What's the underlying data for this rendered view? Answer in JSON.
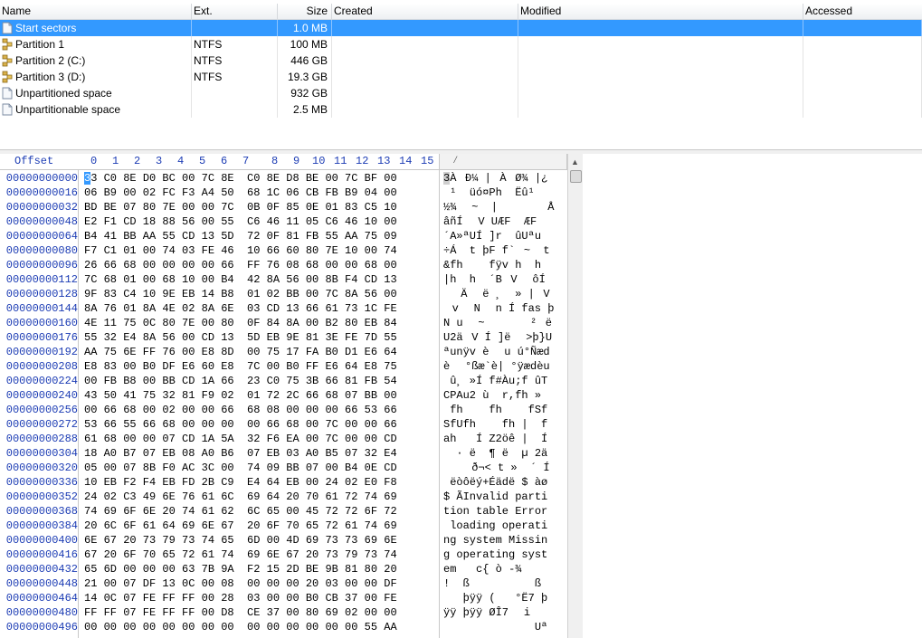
{
  "list": {
    "columns": [
      "Name",
      "Ext.",
      "Size",
      "Created",
      "Modified",
      "Accessed"
    ],
    "rows": [
      {
        "name": "Start sectors",
        "ext": "",
        "size": "1.0 MB",
        "icon": "sector-icon",
        "selected": true
      },
      {
        "name": "Partition 1",
        "ext": "NTFS",
        "size": "100 MB",
        "icon": "partition-icon"
      },
      {
        "name": "Partition 2 (C:)",
        "ext": "NTFS",
        "size": "446 GB",
        "icon": "partition-icon"
      },
      {
        "name": "Partition 3 (D:)",
        "ext": "NTFS",
        "size": "19.3 GB",
        "icon": "partition-icon"
      },
      {
        "name": "Unpartitioned space",
        "ext": "",
        "size": "932 GB",
        "icon": "sector-icon"
      },
      {
        "name": "Unpartitionable space",
        "ext": "",
        "size": "2.5 MB",
        "icon": "sector-icon"
      }
    ]
  },
  "hex": {
    "offset_label": "Offset",
    "col_headers": [
      "0",
      "1",
      "2",
      "3",
      "4",
      "5",
      "6",
      "7",
      "8",
      "9",
      "10",
      "11",
      "12",
      "13",
      "14",
      "15"
    ],
    "lines": [
      {
        "off": "00000000000",
        "bytes": "33 C0 8E D0 BC 00 7C 8E  C0 8E D8 BE 00 7C BF 00",
        "ascii": "3ÀĐ¼ |ÀØ¾ |¿"
      },
      {
        "off": "00000000016",
        "bytes": "06 B9 00 02 FC F3 A4 50  68 1C 06 CB FB B9 04 00",
        "ascii": " ¹  üó¤Ph  Ëû¹"
      },
      {
        "off": "00000000032",
        "bytes": "BD BE 07 80 7E 00 00 7C  0B 0F 85 0E 01 83 C5 10",
        "ascii": "½¾ ~  |     Å"
      },
      {
        "off": "00000000048",
        "bytes": "E2 F1 CD 18 88 56 00 55  C6 46 11 05 C6 46 10 00",
        "ascii": "âñÍ V UÆF  ÆF"
      },
      {
        "off": "00000000064",
        "bytes": "B4 41 BB AA 55 CD 13 5D  72 0F 81 FB 55 AA 75 09",
        "ascii": "´A»ªUÍ ]r  ûUªu"
      },
      {
        "off": "00000000080",
        "bytes": "F7 C1 01 00 74 03 FE 46  10 66 60 80 7E 10 00 74",
        "ascii": "÷Á  t þF f`~  t"
      },
      {
        "off": "00000000096",
        "bytes": "26 66 68 00 00 00 00 66  FF 76 08 68 00 00 68 00",
        "ascii": "&fh    fÿv h  h"
      },
      {
        "off": "00000000112",
        "bytes": "7C 68 01 00 68 10 00 B4  42 8A 56 00 8B F4 CD 13",
        "ascii": "|h  h  ´BV ôÍ"
      },
      {
        "off": "00000000128",
        "bytes": "9F 83 C4 10 9E EB 14 B8  01 02 BB 00 7C 8A 56 00",
        "ascii": "Ä ë ¸  » |V"
      },
      {
        "off": "00000000144",
        "bytes": "8A 76 01 8A 4E 02 8A 6E  03 CD 13 66 61 73 1C FE",
        "ascii": "v N n Í fas þ"
      },
      {
        "off": "00000000160",
        "bytes": "4E 11 75 0C 80 7E 00 80  0F 84 8A 00 B2 80 EB 84",
        "ascii": "N u ~   ²ë"
      },
      {
        "off": "00000000176",
        "bytes": "55 32 E4 8A 56 00 CD 13  5D EB 9E 81 3E FE 7D 55",
        "ascii": "U2äV Í ]ë >þ}U"
      },
      {
        "off": "00000000192",
        "bytes": "AA 75 6E FF 76 00 E8 8D  00 75 17 FA B0 D1 E6 64",
        "ascii": "ªunÿv è u ú°Ñæd"
      },
      {
        "off": "00000000208",
        "bytes": "E8 83 00 B0 DF E6 60 E8  7C 00 B0 FF E6 64 E8 75",
        "ascii": "è °ßæ`è| °ÿædèu"
      },
      {
        "off": "00000000224",
        "bytes": "00 FB B8 00 BB CD 1A 66  23 C0 75 3B 66 81 FB 54",
        "ascii": " û¸ »Í f#Àu;f ûT"
      },
      {
        "off": "00000000240",
        "bytes": "43 50 41 75 32 81 F9 02  01 72 2C 66 68 07 BB 00",
        "ascii": "CPAu2 ù  r,fh »"
      },
      {
        "off": "00000000256",
        "bytes": "00 66 68 00 02 00 00 66  68 08 00 00 00 66 53 66",
        "ascii": " fh    fh    fSf"
      },
      {
        "off": "00000000272",
        "bytes": "53 66 55 66 68 00 00 00  00 66 68 00 7C 00 00 66",
        "ascii": "SfUfh    fh |  f"
      },
      {
        "off": "00000000288",
        "bytes": "61 68 00 00 07 CD 1A 5A  32 F6 EA 00 7C 00 00 CD",
        "ascii": "ah   Í Z2öê |  Í"
      },
      {
        "off": "00000000304",
        "bytes": "18 A0 B7 07 EB 08 A0 B6  07 EB 03 A0 B5 07 32 E4",
        "ascii": "  · ë  ¶ ë  µ 2ä"
      },
      {
        "off": "00000000320",
        "bytes": "05 00 07 8B F0 AC 3C 00  74 09 BB 07 00 B4 0E CD",
        "ascii": "   ð¬< t »  ´ Í"
      },
      {
        "off": "00000000336",
        "bytes": "10 EB F2 F4 EB FD 2B C9  E4 64 EB 00 24 02 E0 F8",
        "ascii": " ëòôëý+Éädë $ àø"
      },
      {
        "off": "00000000352",
        "bytes": "24 02 C3 49 6E 76 61 6C  69 64 20 70 61 72 74 69",
        "ascii": "$ ÃInvalid parti"
      },
      {
        "off": "00000000368",
        "bytes": "74 69 6F 6E 20 74 61 62  6C 65 00 45 72 72 6F 72",
        "ascii": "tion table Error"
      },
      {
        "off": "00000000384",
        "bytes": "20 6C 6F 61 64 69 6E 67  20 6F 70 65 72 61 74 69",
        "ascii": " loading operati"
      },
      {
        "off": "00000000400",
        "bytes": "6E 67 20 73 79 73 74 65  6D 00 4D 69 73 73 69 6E",
        "ascii": "ng system Missin"
      },
      {
        "off": "00000000416",
        "bytes": "67 20 6F 70 65 72 61 74  69 6E 67 20 73 79 73 74",
        "ascii": "g operating syst"
      },
      {
        "off": "00000000432",
        "bytes": "65 6D 00 00 00 63 7B 9A  F2 15 2D BE 9B 81 80 20",
        "ascii": "em   c{ò -¾ "
      },
      {
        "off": "00000000448",
        "bytes": "21 00 07 DF 13 0C 00 08  00 00 00 20 03 00 00 DF",
        "ascii": "!  ß          ß"
      },
      {
        "off": "00000000464",
        "bytes": "14 0C 07 FE FF FF 00 28  03 00 00 B0 CB 37 00 FE",
        "ascii": "   þÿÿ (   °Ë7 þ"
      },
      {
        "off": "00000000480",
        "bytes": "FF FF 07 FE FF FF 00 D8  CE 37 00 80 69 02 00 00",
        "ascii": "ÿÿ þÿÿ ØÎ7 i"
      },
      {
        "off": "00000000496",
        "bytes": "00 00 00 00 00 00 00 00  00 00 00 00 00 00 55 AA",
        "ascii": "              Uª"
      }
    ]
  }
}
